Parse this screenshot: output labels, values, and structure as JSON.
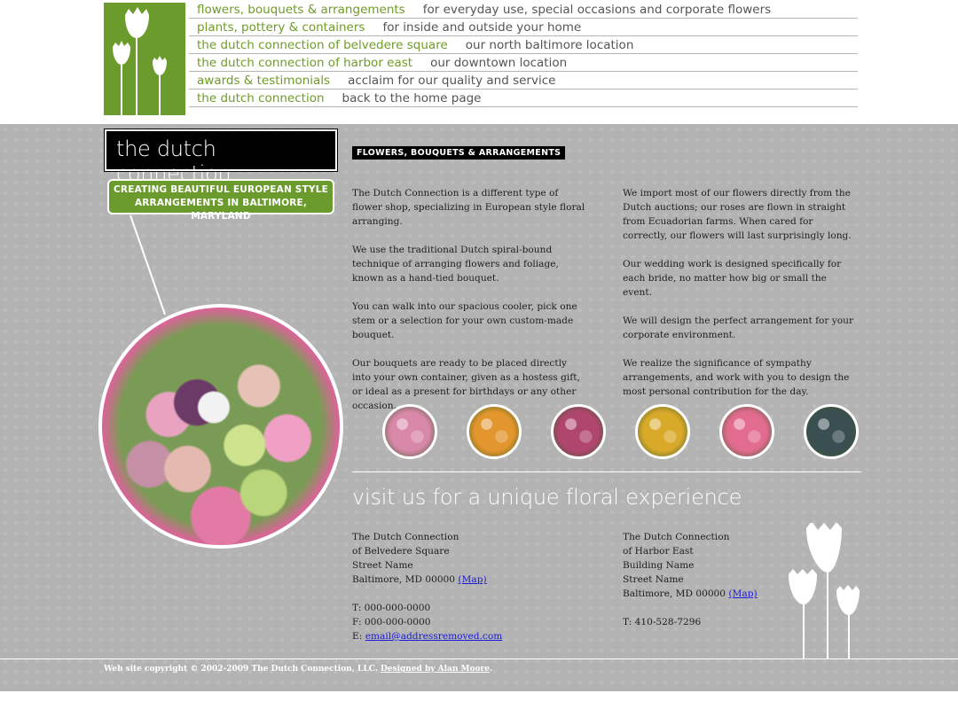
{
  "nav": [
    {
      "link": "flowers, bouquets & arrangements",
      "desc": "for everyday use, special occasions and corporate flowers"
    },
    {
      "link": "plants, pottery & containers",
      "desc": "for inside and outside your home"
    },
    {
      "link": "the dutch connection of belvedere square",
      "desc": "our north baltimore location"
    },
    {
      "link": "the dutch connection of harbor east",
      "desc": "our downtown location"
    },
    {
      "link": "awards & testimonials",
      "desc": "acclaim for our quality and service"
    },
    {
      "link": "the dutch connection",
      "desc": "back to the home page"
    }
  ],
  "brand": {
    "name": "the dutch connection",
    "tagline_line1": "CREATING BEAUTIFUL EUROPEAN STYLE",
    "tagline_line2": "ARRANGEMENTS IN BALTIMORE, MARYLAND"
  },
  "section": {
    "label": "FLOWERS, BOUQUETS & ARRANGEMENTS"
  },
  "content": {
    "left": [
      "The Dutch Connection is a different type of flower shop, specializing in European style floral arranging.",
      "We use the traditional Dutch spiral-bound technique of arranging flowers and foliage, known as a hand-tied bouquet.",
      "You can walk into our spacious cooler, pick one stem or a selection for your own custom-made bouquet.",
      "Our bouquets are ready to be placed directly into your own container, given as a hostess gift, or ideal as a present for birthdays or any other occasion."
    ],
    "right": [
      "We import most of our flowers directly from the Dutch auctions; our roses are flown in straight from Ecuadorian farms. When cared for correctly, our flowers will last surprisingly long.",
      "Our wedding work is designed specifically for each bride, no matter how big or small the event.",
      "We will design the perfect arrangement for your corporate environment.",
      "We realize the significance of sympathy arrangements, and work with you to design the most personal contribution for the day."
    ]
  },
  "visit": {
    "heading": "visit us for a unique floral experience"
  },
  "locations": {
    "left": {
      "name": "The Dutch Connection",
      "sub": "of Belvedere Square",
      "street": "Street Name",
      "city": "Baltimore, MD 00000",
      "map_label": "(Map)",
      "phone": "T: 000-000-0000",
      "fax": "F: 000-000-0000",
      "email_prefix": "E:",
      "email": "email@addressremoved.com"
    },
    "right": {
      "name": "The Dutch Connection",
      "sub": "of Harbor East",
      "building": "Building Name",
      "street": "Street Name",
      "city": "Baltimore, MD 00000",
      "map_label": "(Map)",
      "phone": "T: 410-528-7296"
    }
  },
  "footer": {
    "copyright": "Web site copyright © 2002-2009 The Dutch Connection, LLC.",
    "designer_link": "Designed by Alan Moore",
    "end": "."
  },
  "colors": {
    "brand_green": "#6a9b2c",
    "link_green": "#6f9c28",
    "band_grey": "#b3b3b3"
  },
  "thumbnails": [
    {
      "icon": "bouquet-photo-pink",
      "bg": "#d888a8"
    },
    {
      "icon": "bouquet-photo-orange",
      "bg": "#e3962d"
    },
    {
      "icon": "bouquet-photo-mixed",
      "bg": "#b0466e"
    },
    {
      "icon": "bouquet-photo-yellow",
      "bg": "#d9a92a"
    },
    {
      "icon": "bouquet-photo-gerbera",
      "bg": "#e26c8f"
    },
    {
      "icon": "shop-photo-display",
      "bg": "#3a4f52"
    }
  ]
}
